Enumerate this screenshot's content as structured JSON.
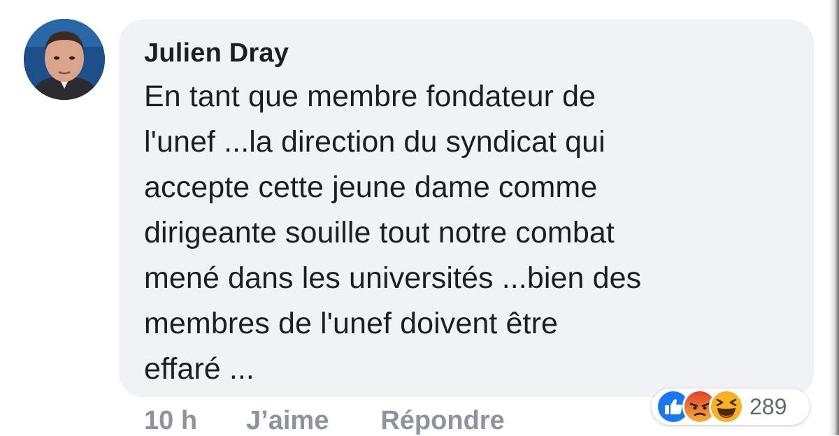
{
  "comment": {
    "author": "Julien Dray",
    "text": "En tant que membre fondateur de\nl'unef ...la direction du syndicat qui\naccepte cette jeune dame comme\ndirigeante souille tout notre combat\nmené dans les universités ...bien des\nmembres de l'unef doivent être\neffaré ..."
  },
  "actions": {
    "time": "10 h",
    "like_label": "J’aime",
    "reply_label": "Répondre"
  },
  "reactions": {
    "icons": [
      "like-icon",
      "angry-icon",
      "haha-icon"
    ],
    "count": "289"
  },
  "colors": {
    "bubble_bg": "#f0f2f5",
    "text": "#1c1e21",
    "meta": "#8d949e",
    "like_blue": "#1877f2",
    "angry_orange": "#e9710f",
    "haha_yellow": "#f7b125"
  }
}
